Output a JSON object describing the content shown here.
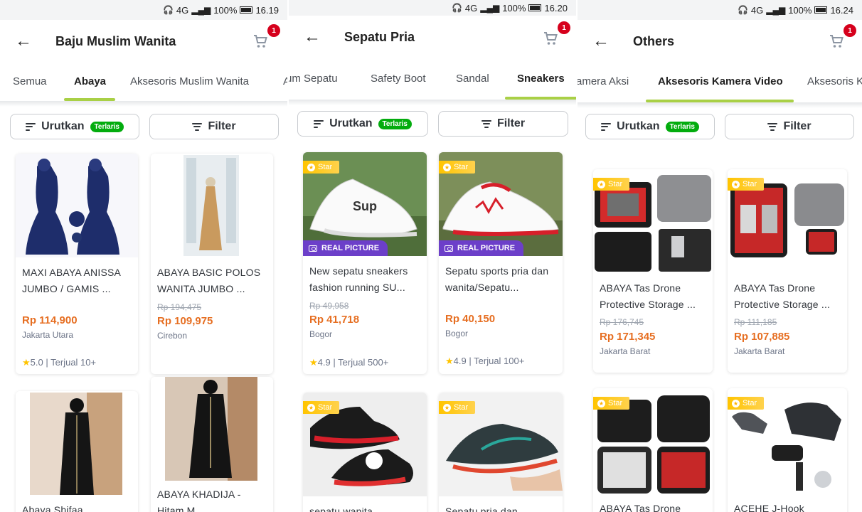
{
  "panels": [
    {
      "status_time": "16.19",
      "status_battery": "100%",
      "status_network": "4G",
      "title": "Baju Muslim Wanita",
      "cart_count": "1",
      "tabs": [
        "Semua",
        "Abaya",
        "Aksesoris Muslim Wanita",
        "A"
      ],
      "active_tab": "Abaya",
      "sort_label": "Urutkan",
      "sort_pill": "Terlaris",
      "filter_label": "Filter",
      "products": [
        {
          "name": "MAXI ABAYA ANISSA JUMBO / GAMIS ...",
          "strike": "",
          "price": "Rp 114,900",
          "location": "Jakarta Utara",
          "rating": "5.0",
          "sold": "Terjual 10+"
        },
        {
          "name": "ABAYA  BASIC POLOS WANITA JUMBO ...",
          "strike": "Rp 194,475",
          "price": "Rp 109,975",
          "location": "Cirebon",
          "rating": "",
          "sold": ""
        },
        {
          "name": "Abaya Shifaa",
          "strike": "",
          "price": "",
          "location": "",
          "rating": "",
          "sold": ""
        },
        {
          "name": "ABAYA KHADIJA - Hitam M",
          "strike": "",
          "price": "",
          "location": "",
          "rating": "",
          "sold": ""
        }
      ]
    },
    {
      "status_time": "16.20",
      "status_battery": "100%",
      "status_network": "4G",
      "title": "Sepatu Pria",
      "cart_count": "1",
      "tabs": [
        "um Sepatu",
        "Safety Boot",
        "Sandal",
        "Sneakers"
      ],
      "active_tab": "Sneakers",
      "sort_label": "Urutkan",
      "sort_pill": "Terlaris",
      "filter_label": "Filter",
      "star_label": "Star",
      "real_picture_label": "REAL PICTURE",
      "products": [
        {
          "name": "New sepatu sneakers fashion running SU...",
          "strike": "Rp 49,958",
          "price": "Rp 41,718",
          "location": "Bogor",
          "rating": "4.9",
          "sold": "Terjual 500+"
        },
        {
          "name": "Sepatu sports pria dan wanita/Sepatu...",
          "strike": "",
          "price": "Rp 40,150",
          "location": "Bogor",
          "rating": "4.9",
          "sold": "Terjual 100+"
        },
        {
          "name": "sepatu wanita",
          "strike": "",
          "price": "",
          "location": "",
          "rating": "",
          "sold": ""
        },
        {
          "name": "Sepatu pria dan",
          "strike": "",
          "price": "",
          "location": "",
          "rating": "",
          "sold": ""
        }
      ]
    },
    {
      "status_time": "16.24",
      "status_battery": "100%",
      "status_network": "4G",
      "title": "Others",
      "cart_count": "1",
      "tabs": [
        "amera Aksi",
        "Aksesoris Kamera Video",
        "Aksesoris K"
      ],
      "active_tab": "Aksesoris Kamera Video",
      "sort_label": "Urutkan",
      "sort_pill": "Terlaris",
      "filter_label": "Filter",
      "star_label": "Star",
      "products": [
        {
          "name": "ABAYA Tas Drone Protective Storage ...",
          "strike": "Rp 176,745",
          "price": "Rp 171,345",
          "location": "Jakarta Barat",
          "rating": "",
          "sold": ""
        },
        {
          "name": "ABAYA Tas Drone Protective Storage ...",
          "strike": "Rp 111,185",
          "price": "Rp 107,885",
          "location": "Jakarta Barat",
          "rating": "",
          "sold": ""
        },
        {
          "name": "ABAYA Tas Drone",
          "strike": "",
          "price": "",
          "location": "",
          "rating": "",
          "sold": ""
        },
        {
          "name": "ACEHE J-Hook",
          "strike": "",
          "price": "",
          "location": "",
          "rating": "",
          "sold": ""
        }
      ]
    }
  ],
  "rating_separator": "|",
  "icons": {
    "back": "arrow-left-icon",
    "cart": "shopping-cart-icon",
    "sort": "sort-lines-icon",
    "filter": "filter-lines-icon",
    "star": "star-icon",
    "camera": "camera-icon"
  },
  "colors": {
    "accent_green": "#03ac0e",
    "tab_underline": "#a9d046",
    "price_orange": "#e66e21",
    "badge_red": "#d6001c",
    "real_picture_purple": "#6c3fc9",
    "star_yellow": "#ffc400"
  }
}
